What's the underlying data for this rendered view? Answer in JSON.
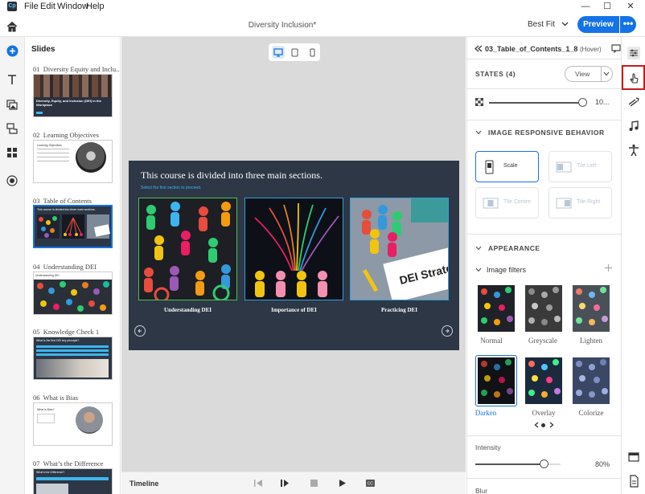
{
  "menubar": {
    "app_logo": "Cp",
    "items": [
      "File",
      "Edit",
      "Window",
      "Help"
    ],
    "min": "—",
    "max": "☐",
    "close": "✕"
  },
  "header": {
    "doc_title": "Diversity Inclusion*",
    "zoom": "Best Fit",
    "preview": "Preview",
    "more": "•••"
  },
  "slides": {
    "title": "Slides",
    "items": [
      {
        "num": "01",
        "title": "Diversity Equity and Inclu...",
        "selected": false
      },
      {
        "num": "02",
        "title": "Learning Objectives",
        "selected": false
      },
      {
        "num": "03",
        "title": "Table of Contents",
        "selected": true
      },
      {
        "num": "04",
        "title": "Understanding DEI",
        "selected": false
      },
      {
        "num": "05",
        "title": "Knowledge Check 1",
        "selected": false
      },
      {
        "num": "06",
        "title": "What is Bias",
        "selected": false
      },
      {
        "num": "07",
        "title": "What’s the Difference",
        "selected": false
      }
    ],
    "thumb1_title": "Diversity, Equity, and Inclusion (DEI) in the Workplace",
    "thumb2_heading": "Learning Objectives",
    "thumb3_title": "This course is divided into three main sections.",
    "thumb4_title": "Understanding DEI",
    "thumb5_q": "What is the first DEI key principle?",
    "thumb6_title": "What is Bias?",
    "thumb7_title": "What's the Difference?"
  },
  "canvas": {
    "slide_title": "This course is divided into three main sections.",
    "slide_subtitle": "Select the first section to proceed.",
    "cards": [
      "Understanding DEI",
      "Importance of DEI",
      "Practicing DEI"
    ],
    "card3_sign": "DEI Strate"
  },
  "timeline": {
    "label": "Timeline"
  },
  "props": {
    "object_name": "03_Table_of_Contents_1_8",
    "state_tag": "(Hover)",
    "states_label": "STATES (4)",
    "view_label": "View",
    "opacity_value": "10...",
    "responsive_header": "IMAGE RESPONSIVE BEHAVIOR",
    "behaviors": [
      "Scale",
      "Tile Left",
      "Tile Centre",
      "Tile Right"
    ],
    "appearance_header": "APPEARANCE",
    "image_filters_label": "Image filters",
    "filters": [
      "Normal",
      "Greyscale",
      "Lighten",
      "Darken",
      "Overlay",
      "Colorize"
    ],
    "selected_filter": "Darken",
    "intensity_label": "Intensity",
    "intensity_value": "80%",
    "intensity_fraction": 0.8,
    "blur_label": "Blur"
  },
  "colors": {
    "accent": "#1473e6",
    "highlight_box": "#c61b1b",
    "slide_bg": "#2d3746",
    "card_border": "#2da2dd"
  }
}
